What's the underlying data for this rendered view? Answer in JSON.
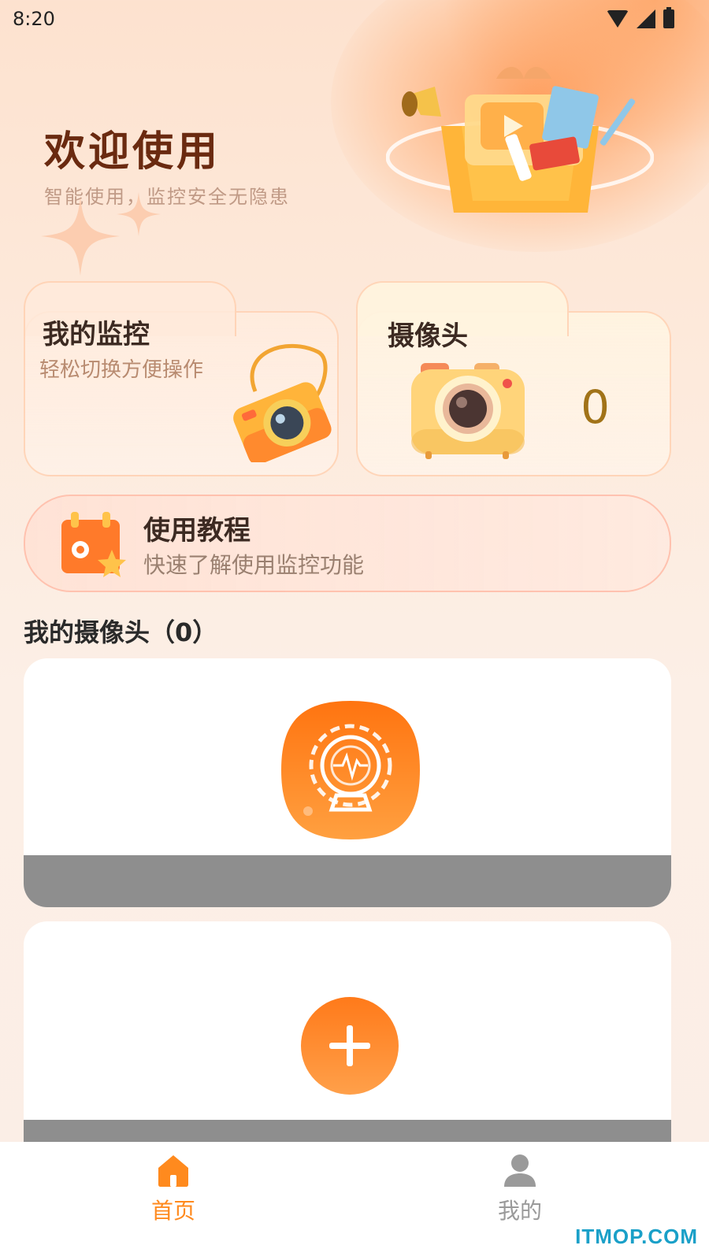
{
  "status_bar": {
    "time": "8:20"
  },
  "hero": {
    "title": "欢迎使用",
    "subtitle": "智能使用，监控安全无隐患"
  },
  "cards": {
    "monitor": {
      "title": "我的监控",
      "desc": "轻松切换方便操作"
    },
    "camera": {
      "title": "摄像头",
      "count": "0"
    }
  },
  "tutorial": {
    "title": "使用教程",
    "desc": "快速了解使用监控功能"
  },
  "my_cameras": {
    "title": "我的摄像头（0）"
  },
  "bottom_nav": {
    "items": [
      {
        "label": "首页",
        "icon": "home-icon",
        "active": true
      },
      {
        "label": "我的",
        "icon": "user-icon",
        "active": false
      }
    ]
  },
  "watermark": "ITMOP.COM",
  "colors": {
    "accent": "#ff8a1e",
    "brand_dark": "#6a2a10",
    "inactive": "#9a9a9a"
  }
}
